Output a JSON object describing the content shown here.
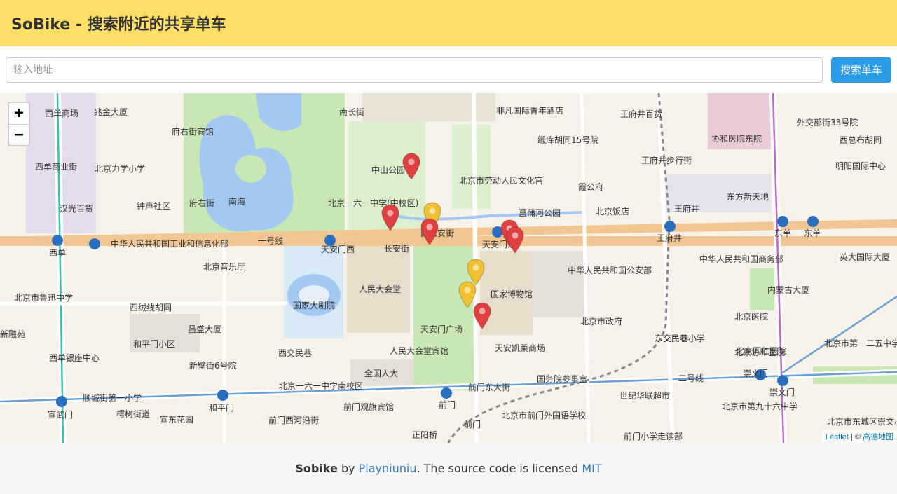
{
  "header": {
    "title": "SoBike - 搜索附近的共享单车"
  },
  "search": {
    "placeholder": "输入地址",
    "button_label": "搜索单车"
  },
  "map": {
    "zoom_in": "+",
    "zoom_out": "−",
    "attribution": {
      "leaflet": "Leaflet",
      "sep": " | © ",
      "provider": "高德地图"
    },
    "labels": [
      "西单商场",
      "兆金大厦",
      "府右街宾馆",
      "南长街",
      "非凡国际青年酒店",
      "王府井百货",
      "外交部街33号院",
      "西总布胡同",
      "西单商业街",
      "北京力学小学",
      "中山公园",
      "北京市劳动人民文化宫",
      "缎库胡同15号院",
      "王府井步行街",
      "协和医院东院",
      "明阳国际中心",
      "汉光百货",
      "钟声社区",
      "府右街",
      "南海",
      "北京一六一中学(中校区)",
      "菖蒲河公园",
      "霞公府",
      "北京饭店",
      "王府井",
      "东方新天地",
      "西单",
      "中华人民共和国工业和信息化部",
      "一号线",
      "天安门西",
      "长安街",
      "西长安街",
      "天安门东",
      "王府井",
      "东单",
      "东单",
      "北京音乐厅",
      "人民大会堂",
      "国家大剧院",
      "国家博物馆",
      "中华人民共和国公安部",
      "中华人民共和国商务部",
      "英大国际大厦",
      "内蒙古大厦",
      "北京市鲁迅中学",
      "西绒线胡同",
      "昌盛大厦",
      "天安门广场",
      "北京市政府",
      "北京医院",
      "东交民巷小学",
      "北京协和医院",
      "和平门小区",
      "新融苑",
      "西单银座中心",
      "新壁街6号院",
      "人民大会堂宾馆",
      "天安凯莱商场",
      "北京同仁医院",
      "北京市第一二五中学",
      "西交民巷",
      "全国人大",
      "北京一六一中学南校区",
      "国务院参事室",
      "二号线",
      "崇文门",
      "崇文门",
      "顺城街第一小学",
      "宣武门",
      "和平门",
      "前门东大街",
      "前门观旗宾馆",
      "前门",
      "世纪华联超市",
      "北京市第九十六中学",
      "北京市东城区崇文小年宫",
      "宣东花园",
      "樗树街道",
      "前门西河沿街",
      "前门",
      "北京市前门外国语学校",
      "正阳桥",
      "前门小学走读部",
      "东交民巷"
    ]
  },
  "footer": {
    "project": "Sobike",
    "by": " by ",
    "author": "Playniuniu",
    "text": ". The source code is licensed ",
    "license": "MIT"
  }
}
